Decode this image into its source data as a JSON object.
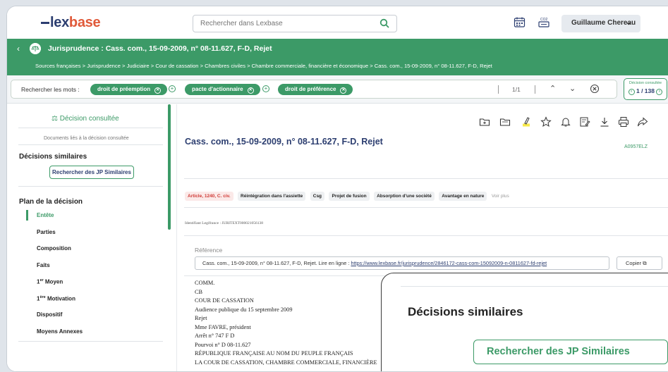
{
  "header": {
    "logo_lex": "lex",
    "logo_base": "base",
    "search_placeholder": "Rechercher dans Lexbase",
    "user_name": "Guillaume Chereau",
    "icons": [
      "calendar-icon",
      "co2-icon"
    ]
  },
  "titlebar": {
    "title": "Jurisprudence : Cass. com., 15-09-2009, n° 08-11.627, F-D, Rejet",
    "breadcrumb": "Sources françaises > Jurisprudence > Judiciaire > Cour de cassation > Chambres civiles > Chambre commerciale, financière et économique > Cass. com., 15-09-2009, n° 08-11.627, F-D, Rejet"
  },
  "search_terms": {
    "label": "Rechercher les mots :",
    "chips": [
      "droit de préemption",
      "pacte d'actionnaire",
      "droit de préférence"
    ],
    "counter": "1/1",
    "decision_label": "Décision consultée",
    "decision_counter": "1 / 138"
  },
  "sidebar": {
    "decision_consultee": "Décision consultée",
    "docs_lies": "Documents liés à la décision consultée",
    "decisions_similaires": "Décisions similaires",
    "rechercher_btn": "Rechercher des JP Similaires",
    "plan_title": "Plan de la décision",
    "plan_items": [
      "Entête",
      "Parties",
      "Composition",
      "Faits",
      "1",
      "Moyen",
      "1",
      "Motivation",
      "Dispositif",
      "Moyens Annexes"
    ],
    "plan_sups": [
      "er",
      "ère"
    ]
  },
  "main": {
    "doc_title": "Cass. com., 15-09-2009, n° 08-11.627, F-D, Rejet",
    "doc_ref": "A0957ELZ",
    "tags": [
      "Article, 1240, C. civ.",
      "Réintégration dans l'assiette",
      "Csg",
      "Projet de fusion",
      "Absorption d'une société",
      "Avantage en nature"
    ],
    "voir_plus": "Voir plus",
    "legifrance": "Identifiant Legifrance : JURITEXT000021056138",
    "reference_label": "Référence",
    "reference_text": "Cass. com., 15-09-2009, n° 08-11.627, F-D, Rejet. Lire en ligne : ",
    "reference_link": "https://www.lexbase.fr/jurisprudence/2846172-cass-com-15092009-n-0811627-fd-rejet",
    "copy_label": "Copier",
    "body_lines": [
      "COMM.",
      "CB",
      "COUR DE CASSATION",
      "Audience publique du 15 septembre 2009",
      "Rejet",
      "Mme FAVRE, président",
      "Arrêt n° 747 F D",
      "Pourvoi n° D 08-11.627",
      "RÉPUBLIQUE FRANÇAISE AU NOM DU PEUPLE FRANÇAIS",
      "LA COUR DE CASSATION, CHAMBRE COMMERCIALE, FINANCIÈRE"
    ]
  },
  "popup": {
    "title": "Décisions similaires",
    "button": "Rechercher des JP Similaires"
  },
  "colors": {
    "accent_green": "#3c9a67",
    "brand_navy": "#2c3e70",
    "brand_orange": "#e05a3a",
    "tag_red": "#d03a36"
  }
}
